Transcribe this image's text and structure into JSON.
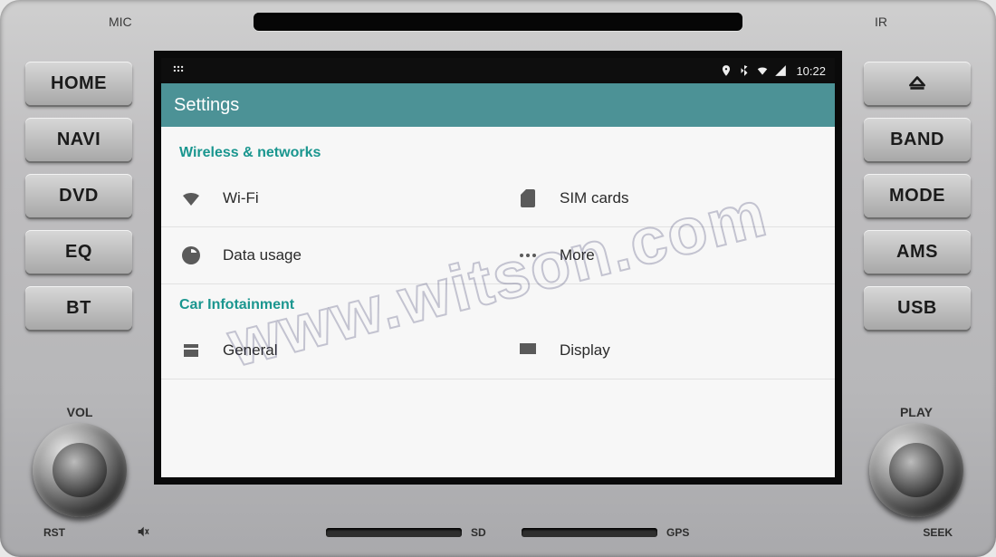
{
  "hardware": {
    "top": {
      "mic": "MIC",
      "ir": "IR"
    },
    "left_buttons": [
      "HOME",
      "NAVI",
      "DVD",
      "EQ",
      "BT"
    ],
    "right_buttons": [
      "__eject__",
      "BAND",
      "MODE",
      "AMS",
      "USB"
    ],
    "left_knob": "VOL",
    "right_knob": "PLAY",
    "bottom": {
      "rst": "RST",
      "seek": "SEEK",
      "sd": "SD",
      "gps": "GPS"
    }
  },
  "statusbar": {
    "time": "10:22"
  },
  "appbar": {
    "title": "Settings"
  },
  "sections": {
    "wireless": {
      "header": "Wireless & networks",
      "items": [
        {
          "icon": "wifi",
          "label": "Wi-Fi"
        },
        {
          "icon": "sim",
          "label": "SIM cards"
        },
        {
          "icon": "data",
          "label": "Data usage"
        },
        {
          "icon": "more",
          "label": "More"
        }
      ]
    },
    "car": {
      "header": "Car Infotainment",
      "items": [
        {
          "icon": "general",
          "label": "General"
        },
        {
          "icon": "display",
          "label": "Display"
        }
      ]
    }
  },
  "watermark": "www.witson.com"
}
